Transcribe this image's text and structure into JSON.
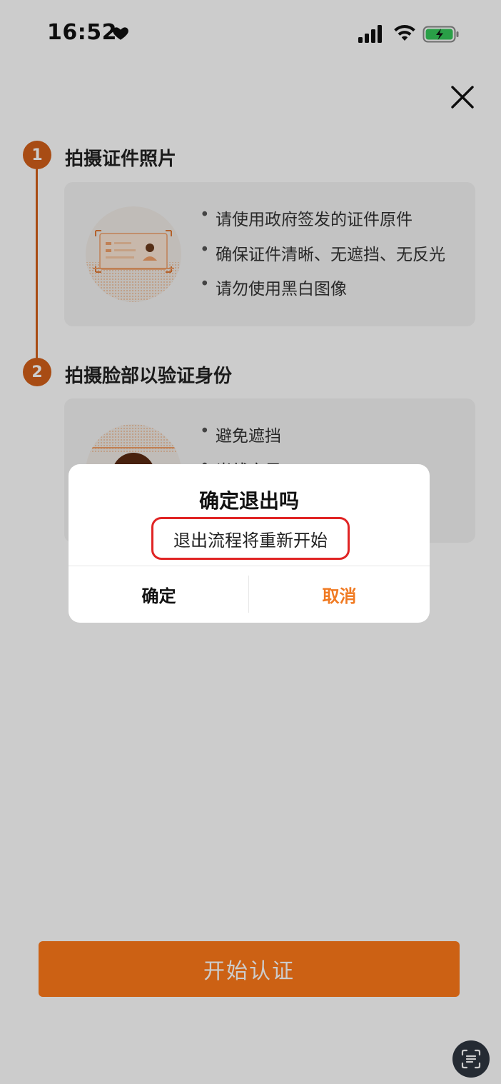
{
  "status_bar": {
    "time": "16:52"
  },
  "steps": [
    {
      "number": "1",
      "title": "拍摄证件照片",
      "bullets": [
        "请使用政府签发的证件原件",
        "确保证件清晰、无遮挡、无反光",
        "请勿使用黑白图像"
      ]
    },
    {
      "number": "2",
      "title": "拍摄脸部以验证身份",
      "bullets": [
        "避免遮挡",
        "光线充足"
      ]
    }
  ],
  "primary_button": {
    "label": "开始认证"
  },
  "dialog": {
    "title": "确定退出吗",
    "message": "退出流程将重新开始",
    "confirm_label": "确定",
    "cancel_label": "取消"
  },
  "colors": {
    "accent": "#d2601a",
    "button": "#ff7a1a",
    "cancel_text": "#f07a22",
    "highlight_border": "#e02424"
  },
  "icons": [
    "heart-icon",
    "signal-icon",
    "wifi-icon",
    "battery-charging-icon",
    "close-icon",
    "id-card-illustration",
    "face-illustration",
    "scan-text-icon"
  ]
}
